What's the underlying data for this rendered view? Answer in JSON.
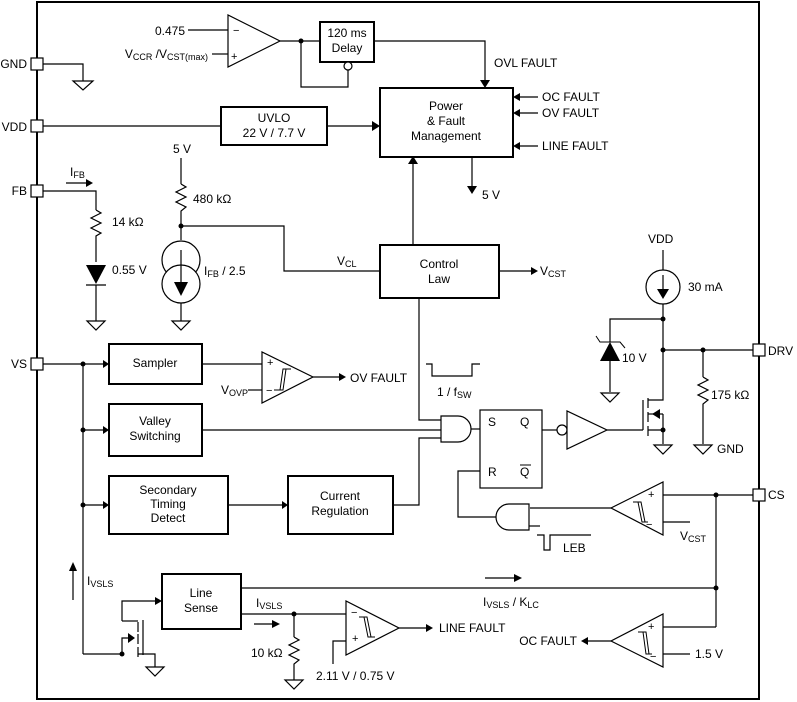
{
  "title": "Functional Block Diagram",
  "pins": {
    "gnd": "GND",
    "vdd": "VDD",
    "fb": "FB",
    "vs": "VS",
    "drv": "DRV",
    "cs": "CS"
  },
  "blocks": {
    "delay": [
      "120 ms",
      "Delay"
    ],
    "uvlo": [
      "UVLO",
      "22 V / 7.7 V"
    ],
    "power_fault": [
      "Power",
      "& Fault",
      "Management"
    ],
    "control_law": [
      "Control",
      "Law"
    ],
    "sampler": [
      "Sampler"
    ],
    "valley_switching": [
      "Valley",
      "Switching"
    ],
    "secondary_timing": [
      "Secondary",
      "Timing",
      "Detect"
    ],
    "current_regulation": [
      "Current",
      "Regulation"
    ],
    "line_sense": [
      "Line",
      "Sense"
    ]
  },
  "flipflop": {
    "s": "S",
    "q": "Q",
    "r": "R",
    "qbar": "Q"
  },
  "labels": {
    "ovl_ref": "0.475",
    "vccr_main": "V",
    "vccr_sub1": "CCR",
    "vccr_mid": " /V",
    "vccr_sub2": "CST(max)",
    "ovl_fault": "OVL FAULT",
    "oc_fault_in": "OC FAULT",
    "ov_fault_in": "OV FAULT",
    "line_fault_in": "LINE FAULT",
    "pfm_5v": "5 V",
    "fb_5v": "5 V",
    "r480": "480 kΩ",
    "r14": "14 kΩ",
    "d055": "0.55 V",
    "ifb_main": "I",
    "ifb_sub": "FB",
    "ifb25_main": "I",
    "ifb25_sub": "FB",
    "ifb25_tail": " / 2.5",
    "vcl_main": "V",
    "vcl_sub": "CL",
    "vcst_main": "V",
    "vcst_sub": "CST",
    "vdd_src": "VDD",
    "i30": "30 mA",
    "z10": "10 V",
    "r175": "175 kΩ",
    "drv_gnd": "GND",
    "vovp_main": "V",
    "vovp_sub": "OVP",
    "ov_fault_out": "OV FAULT",
    "fsw_pre": "1 / f",
    "fsw_sub": "SW",
    "leb": "LEB",
    "vcst2_main": "V",
    "vcst2_sub": "CST",
    "ivsls_main": "I",
    "ivsls_sub": "VSLS",
    "ivsls2_main": "I",
    "ivsls2_sub": "VSLS",
    "klc_main": "I",
    "klc_sub1": "VSLS",
    "klc_mid": " / K",
    "klc_sub2": "LC",
    "r10": "10 kΩ",
    "line_ref": "2.11 V / 0.75 V",
    "line_fault_out": "LINE FAULT",
    "oc_fault_out": "OC FAULT",
    "oc_ref": "1.5 V"
  },
  "comparator_signs": {
    "plus": "+",
    "minus": "−"
  }
}
